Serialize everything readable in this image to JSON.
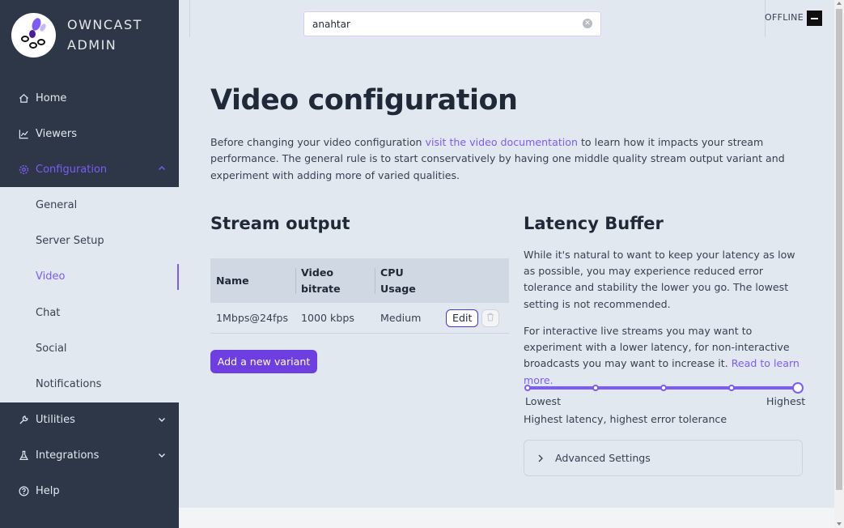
{
  "brand": {
    "line1": "OWNCAST",
    "line2": "ADMIN"
  },
  "sidebar": {
    "items": [
      {
        "label": "Home",
        "icon": "home-icon"
      },
      {
        "label": "Viewers",
        "icon": "chart-line-icon"
      },
      {
        "label": "Configuration",
        "icon": "gear-icon",
        "expanded": true
      },
      {
        "label": "Utilities",
        "icon": "wrench-icon"
      },
      {
        "label": "Integrations",
        "icon": "flask-icon"
      },
      {
        "label": "Help",
        "icon": "question-circle-icon"
      }
    ],
    "config_sub": [
      "General",
      "Server Setup",
      "Video",
      "Chat",
      "Social",
      "Notifications"
    ],
    "active_sub": "Video"
  },
  "header": {
    "search_value": "anahtar",
    "status": "OFFLINE"
  },
  "page": {
    "title": "Video configuration",
    "intro_before": "Before changing your video configuration ",
    "intro_link": "visit the video documentation",
    "intro_after": " to learn how it impacts your stream performance. The general rule is to start conservatively by having one middle quality stream output variant and experiment with adding more of varied qualities."
  },
  "stream_output": {
    "heading": "Stream output",
    "columns": [
      "Name",
      "Video bitrate",
      "CPU Usage"
    ],
    "rows": [
      {
        "name": "1Mbps@24fps",
        "bitrate": "1000 kbps",
        "cpu": "Medium"
      }
    ],
    "edit_label": "Edit",
    "add_label": "Add a new variant"
  },
  "latency": {
    "heading": "Latency Buffer",
    "p1": "While it's natural to want to keep your latency as low as possible, you may experience reduced error tolerance and stability the lower you go. The lowest setting is not recommended.",
    "p2_before": "For interactive live streams you may want to experiment with a lower latency, for non-interactive broadcasts you may want to increase it. ",
    "p2_link": "Read to learn more.",
    "min_label": "Lowest",
    "max_label": "Highest",
    "steps": 5,
    "selected_step": 5,
    "status": "Highest latency, highest error tolerance",
    "advanced_label": "Advanced Settings"
  },
  "colors": {
    "accent": "#7c5cf5",
    "sidebar_bg": "#2d3748",
    "button_primary": "#6d3fe0"
  }
}
